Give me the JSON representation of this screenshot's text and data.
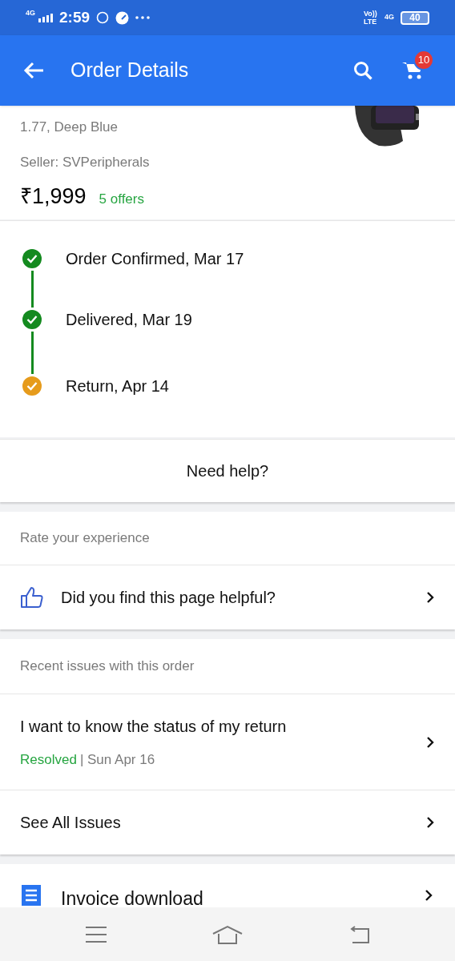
{
  "status_bar": {
    "network": "4G",
    "time": "2:59",
    "volte": "Vo)) LTE",
    "data": "4G",
    "battery": "40"
  },
  "app_bar": {
    "title": "Order Details",
    "cart_count": "10"
  },
  "product": {
    "variant": "1.77, Deep Blue",
    "seller": "Seller: SVPeripherals",
    "price": "₹1,999",
    "offers": "5 offers"
  },
  "timeline": [
    {
      "label": "Order Confirmed, Mar 17",
      "color": "#148a1f"
    },
    {
      "label": "Delivered, Mar 19",
      "color": "#148a1f"
    },
    {
      "label": "Return, Apr 14",
      "color": "#e69b1c"
    }
  ],
  "help": {
    "label": "Need help?"
  },
  "rate": {
    "heading": "Rate your experience",
    "question": "Did you find this page helpful?"
  },
  "issues": {
    "heading": "Recent issues with this order",
    "items": [
      {
        "title": "I want to know the status of my return",
        "status": "Resolved",
        "date": "| Sun Apr 16"
      }
    ],
    "see_all": "See All Issues"
  },
  "invoice": {
    "label": "Invoice download"
  }
}
